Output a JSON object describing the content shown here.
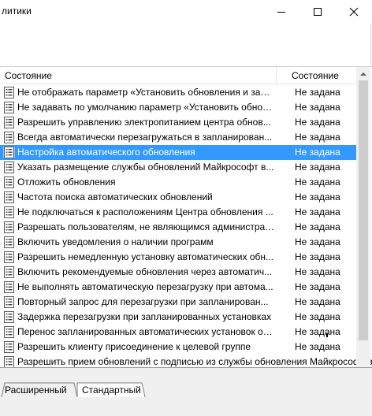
{
  "window": {
    "title": "литики",
    "minimize_icon": "minimize-icon",
    "maximize_icon": "maximize-icon",
    "close_icon": "close-icon"
  },
  "list": {
    "columns": [
      "Состояние",
      "Состояние"
    ],
    "rows": [
      {
        "name": "Не отображать параметр «Установить обновления и заве...",
        "state": "Не задана"
      },
      {
        "name": "Не задавать по умолчанию параметр «Установить обнов...",
        "state": "Не задана"
      },
      {
        "name": "Разрешить управлению электропитанием центра обнов...",
        "state": "Не задана"
      },
      {
        "name": "Всегда автоматически перезагружаться в запланирован...",
        "state": "Не задана"
      },
      {
        "name": "Настройка автоматического обновления",
        "state": "Не задана",
        "selected": true
      },
      {
        "name": "Указать размещение службы обновлений Майкрософт в...",
        "state": "Не задана"
      },
      {
        "name": "Отложить обновления",
        "state": "Не задана"
      },
      {
        "name": "Частота поиска автоматических обновлений",
        "state": "Не задана"
      },
      {
        "name": "Не подключаться к расположениям Центра обновления ...",
        "state": "Не задана"
      },
      {
        "name": "Разрешать пользователям, не являющимся администрат...",
        "state": "Не задана"
      },
      {
        "name": "Включить уведомления о наличии программ",
        "state": "Не задана"
      },
      {
        "name": "Разрешить немедленную установку автоматических обн...",
        "state": "Не задана"
      },
      {
        "name": "Включить рекомендуемые обновления через автоматич...",
        "state": "Не задана"
      },
      {
        "name": "Не выполнять автоматическую перезагрузку при автома...",
        "state": "Не задана"
      },
      {
        "name": "Повторный запрос для перезагрузки при запланирован...",
        "state": "Не задана"
      },
      {
        "name": "Задержка перезагрузки при запланированных установках",
        "state": "Не задана"
      },
      {
        "name": "Перенос запланированных автоматических установок об...",
        "state": "Не задана"
      },
      {
        "name": "Разрешить клиенту присоединение к целевой группе",
        "state": "Не задана"
      },
      {
        "name": "Разрешить прием обновлений с подписью из службы обновления Майкрософт в",
        "state": "",
        "partial": true
      }
    ],
    "row_icon": "policy-setting-icon"
  },
  "tabs": [
    {
      "label": "Расширенный",
      "active": false
    },
    {
      "label": "Стандартный",
      "active": true
    }
  ],
  "colors": {
    "selection": "#3399ff",
    "scrollbar_track": "#f0f0f0",
    "scrollbar_thumb": "#cdcdcd"
  }
}
